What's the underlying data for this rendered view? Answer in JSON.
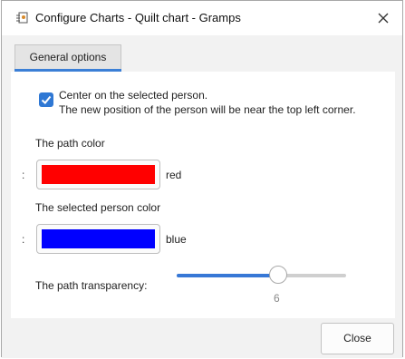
{
  "window": {
    "title": "Configure Charts - Quilt chart - Gramps"
  },
  "tabs": [
    {
      "label": "General options"
    }
  ],
  "options": {
    "center_person": {
      "checked": true,
      "label": "Center on the selected person.",
      "description": "The new position of the person will be near the top left corner."
    },
    "path_color": {
      "label": "The path color",
      "prefix": ":",
      "value_name": "red",
      "color": "#ff0000"
    },
    "selected_color": {
      "label": "The selected person color",
      "prefix": ":",
      "value_name": "blue",
      "color": "#0000ff"
    },
    "path_transparency": {
      "label": "The path transparency:",
      "value": 6,
      "value_text": "6",
      "min": 0,
      "max": 10
    }
  },
  "footer": {
    "close_label": "Close"
  },
  "colors": {
    "accent": "#3778d6"
  },
  "icons": {
    "app": "gramps-configure-icon",
    "close": "close-icon",
    "check": "checkmark-icon"
  }
}
